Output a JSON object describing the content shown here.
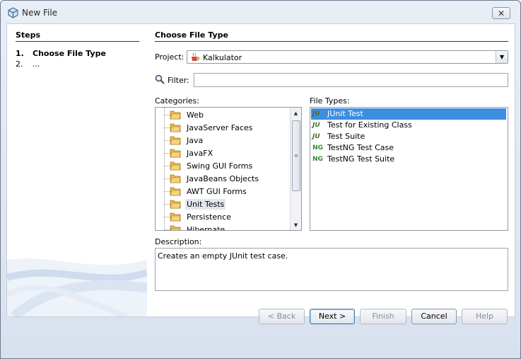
{
  "window": {
    "title": "New File",
    "close_glyph": "✕"
  },
  "steps": {
    "heading": "Steps",
    "items": [
      {
        "num": "1.",
        "label": "Choose File Type"
      },
      {
        "num": "2.",
        "label": "..."
      }
    ]
  },
  "main": {
    "heading": "Choose File Type",
    "project_label": "Project:",
    "project_value": "Kalkulator",
    "filter_label": "Filter:",
    "filter_value": "",
    "categories_label": "Categories:",
    "categories": [
      "Web",
      "JavaServer Faces",
      "Java",
      "JavaFX",
      "Swing GUI Forms",
      "JavaBeans Objects",
      "AWT GUI Forms",
      "Unit Tests",
      "Persistence",
      "Hibernate"
    ],
    "selected_category": "Unit Tests",
    "file_types_label": "File Types:",
    "file_types": [
      {
        "badge": "JU",
        "label": "JUnit Test"
      },
      {
        "badge": "JU",
        "label": "Test for Existing Class"
      },
      {
        "badge": "JU",
        "label": "Test Suite"
      },
      {
        "badge": "NG",
        "label": "TestNG Test Case"
      },
      {
        "badge": "NG",
        "label": "TestNG Test Suite"
      }
    ],
    "selected_file_type": "JUnit Test",
    "description_label": "Description:",
    "description": "Creates an empty JUnit test case."
  },
  "buttons": {
    "back": "< Back",
    "next": "Next >",
    "finish": "Finish",
    "cancel": "Cancel",
    "help": "Help"
  },
  "colors": {
    "selection": "#3d8ee0",
    "folder": "#e8b84a"
  },
  "icons": {
    "title": "netbeans-cube-icon",
    "project": "java-cup-icon",
    "filter": "magnifier-icon",
    "category": "folder-icon"
  }
}
